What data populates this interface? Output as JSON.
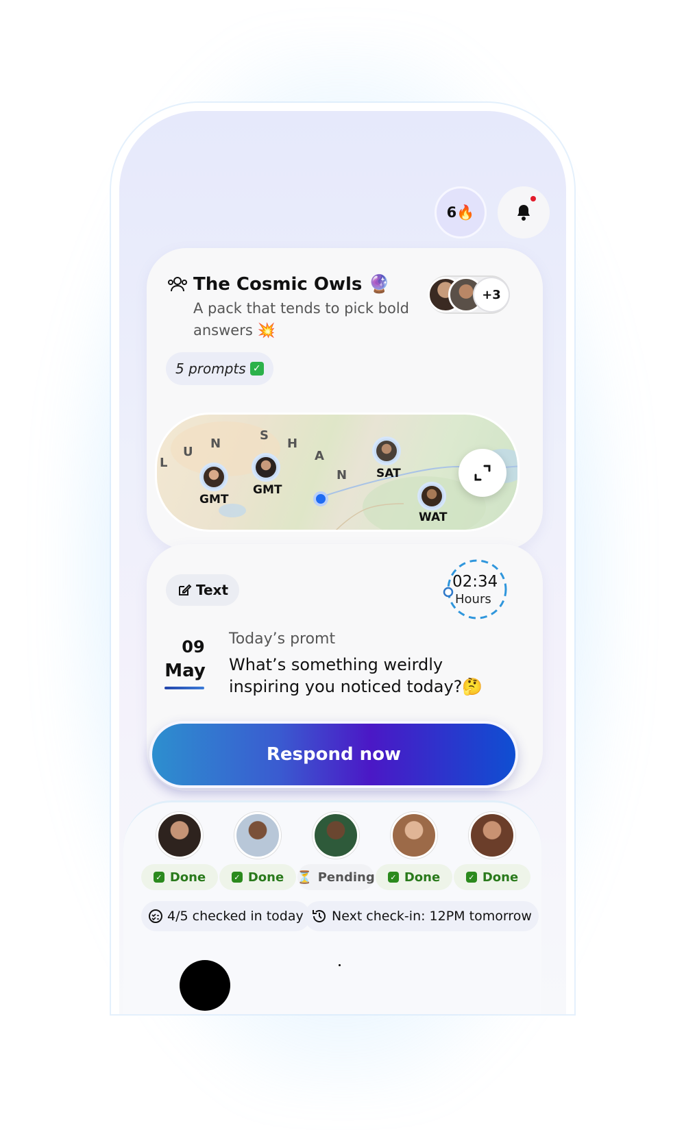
{
  "header": {
    "streak_count": "6",
    "streak_icon": "fire-icon",
    "notification_icon": "bell-icon",
    "has_notification": true
  },
  "pack": {
    "name": "The Cosmic Owls",
    "name_emoji": "🔮",
    "description": "A pack that tends to pick bold answers 💥",
    "extra_members": "+3",
    "prompts_count": "5 prompts",
    "prompts_emoji": "✅"
  },
  "map": {
    "region_letters": [
      "L",
      "U",
      "N",
      "S",
      "H",
      "A",
      "N"
    ],
    "markers": [
      {
        "label": "GMT",
        "flag": "us-flag"
      },
      {
        "label": "GMT",
        "flag": "uk-flag"
      },
      {
        "label": "SAT",
        "flag": "kr-flag"
      },
      {
        "label": "WAT",
        "flag": "sv-flag"
      }
    ]
  },
  "prompt": {
    "type_label": "Text",
    "timer_value": "02:34",
    "timer_unit": "Hours",
    "date_day": "09",
    "date_month": "May",
    "label": "Today’s promt",
    "question": "What’s something weirdly inspiring you noticed today?🤔",
    "respond_label": "Respond now"
  },
  "members": [
    {
      "status": "Done",
      "state": "done"
    },
    {
      "status": "Done",
      "state": "done"
    },
    {
      "status": "Pending",
      "state": "pending"
    },
    {
      "status": "Done",
      "state": "done"
    },
    {
      "status": "Done",
      "state": "done"
    }
  ],
  "summary": {
    "checked_in": "4/5 checked in today",
    "next_checkin": "Next check-in: 12PM tomorrow"
  },
  "colors": {
    "accent_start": "#2d8fcf",
    "accent_mid": "#4b18c6",
    "accent_end": "#0f4fd2",
    "done_green": "#2a7a1c"
  }
}
